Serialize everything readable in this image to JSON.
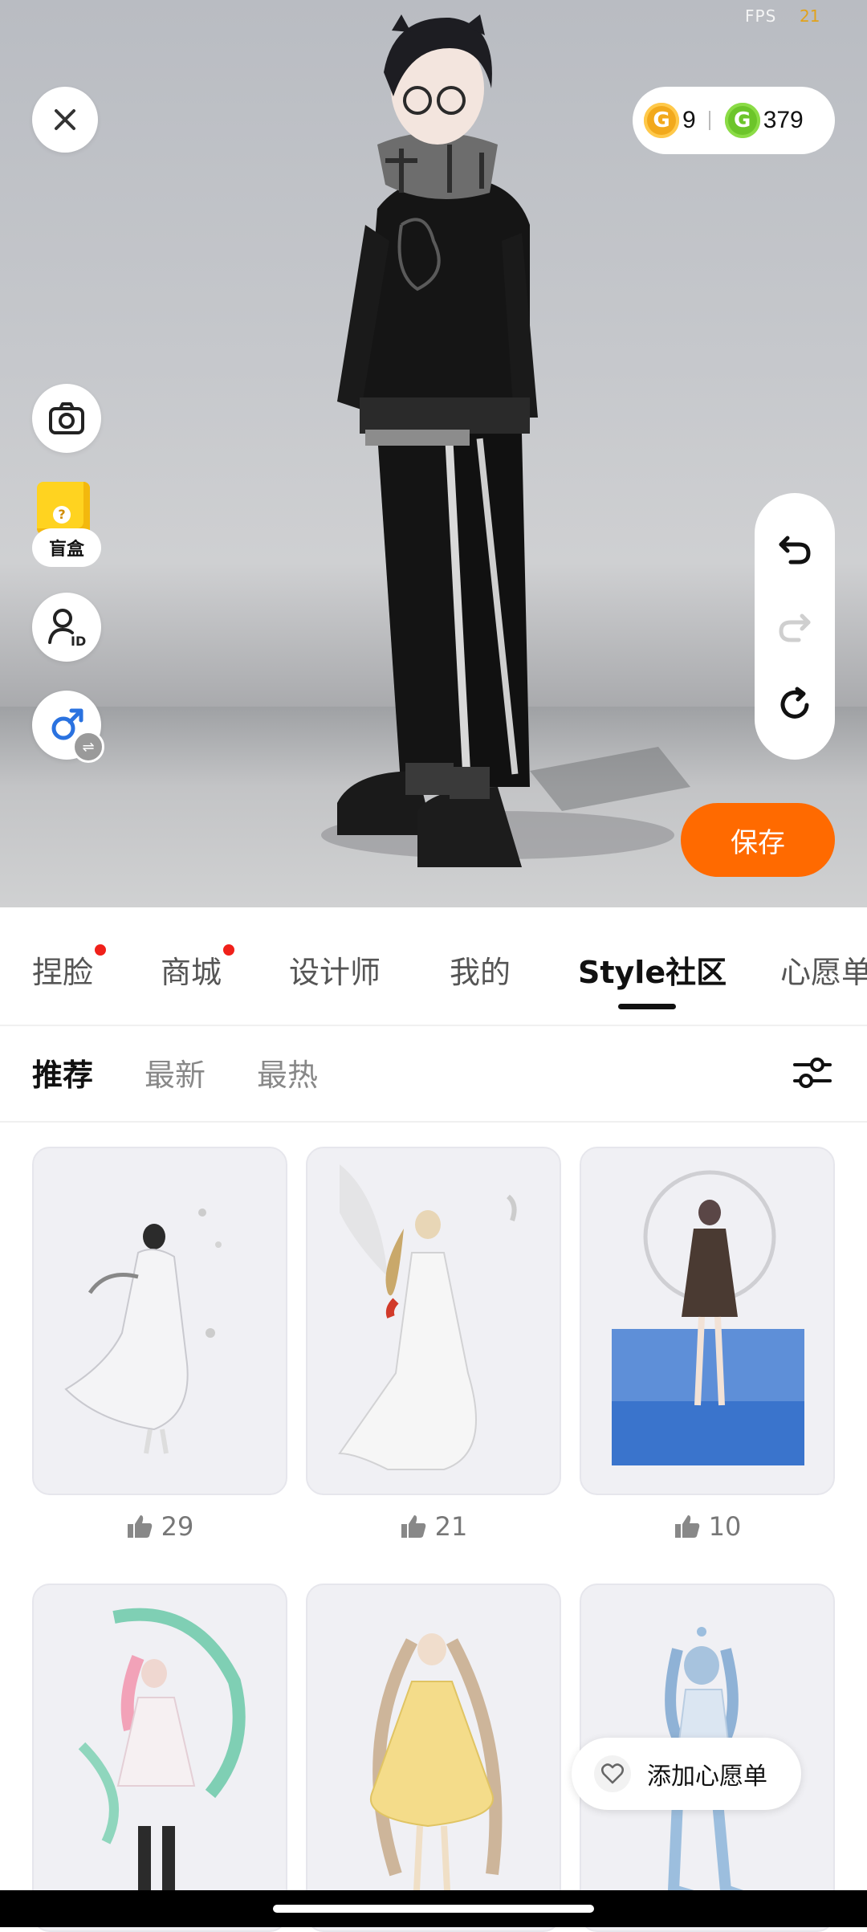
{
  "fps": {
    "label": "FPS",
    "value": "21"
  },
  "currency": {
    "gold_amount": "9",
    "green_amount": "379",
    "gold_glyph": "G",
    "green_glyph": "G",
    "gold_color": "#f2a91c",
    "green_color": "#6cc52a"
  },
  "left_tools": {
    "mystery_box_label": "盲盒",
    "mystery_glyph": "?",
    "gender_swap_glyph": "⇌"
  },
  "save_label": "保存",
  "tabs": [
    {
      "label": "捏脸",
      "dot": true
    },
    {
      "label": "商城",
      "dot": true
    },
    {
      "label": "设计师",
      "dot": false
    },
    {
      "label": "我的",
      "dot": false
    },
    {
      "label": "Style社区",
      "dot": false,
      "active": true
    },
    {
      "label": "心愿单",
      "dot": false
    }
  ],
  "subtabs": [
    {
      "label": "推荐",
      "active": true
    },
    {
      "label": "最新"
    },
    {
      "label": "最热"
    }
  ],
  "posts": [
    {
      "likes": "29"
    },
    {
      "likes": "21"
    },
    {
      "likes": "10"
    },
    {
      "likes": ""
    },
    {
      "likes": ""
    },
    {
      "likes": ""
    }
  ],
  "wishlist_button_label": "添加心愿单",
  "accent_color": "#ff6a00"
}
